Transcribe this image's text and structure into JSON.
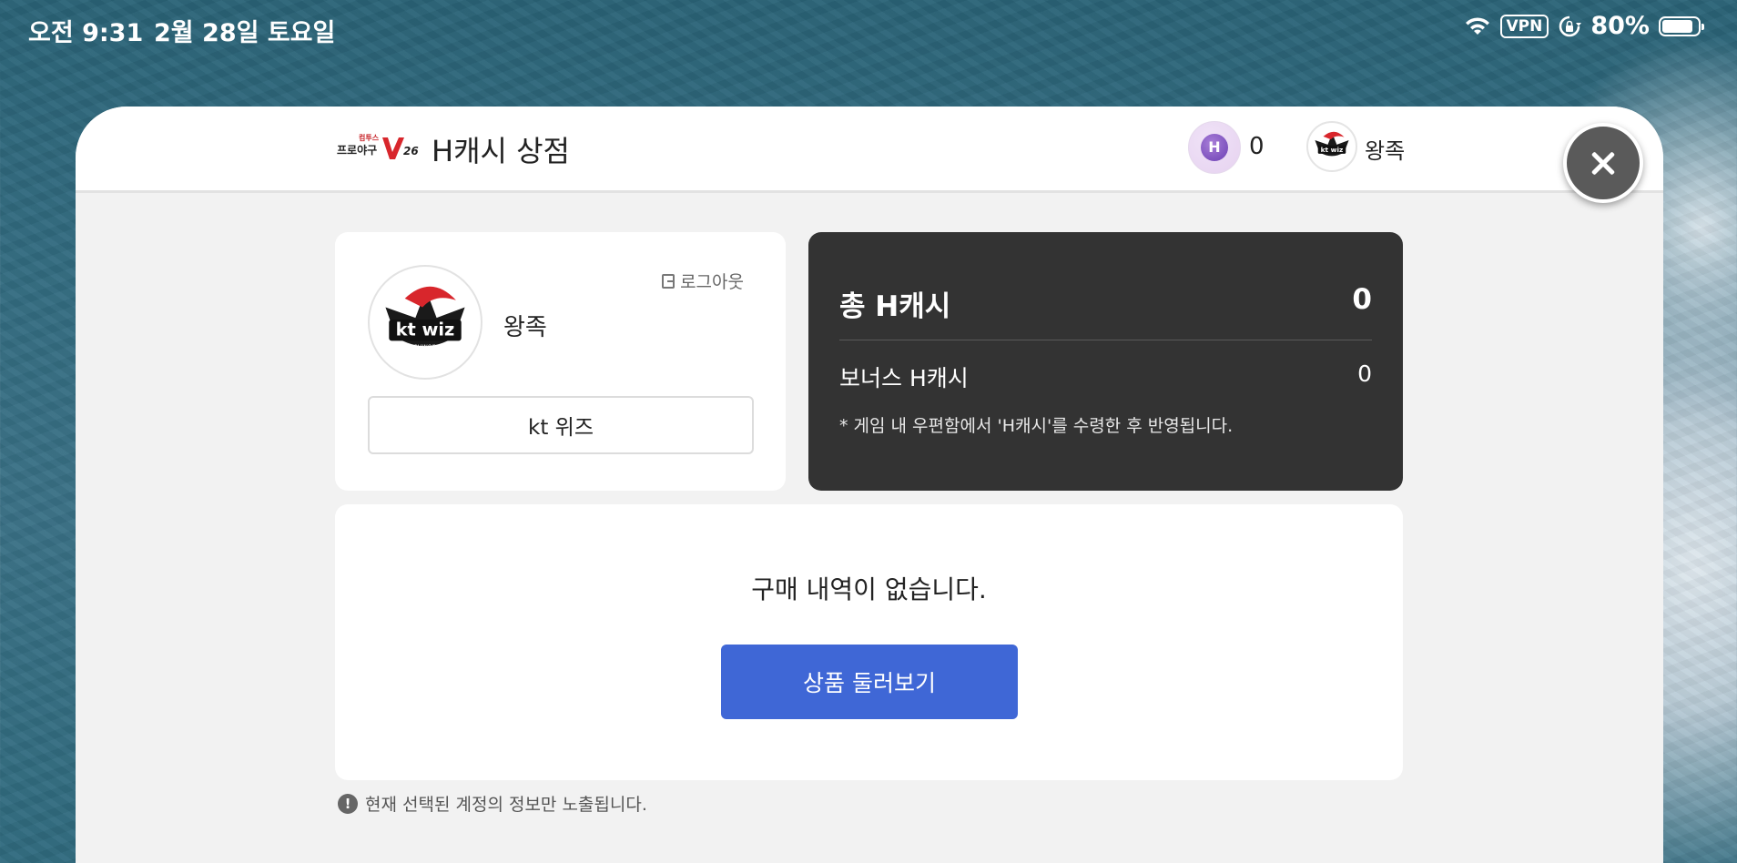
{
  "statusbar": {
    "time": "오전 9:31",
    "date": "2월 28일 토요일",
    "vpn": "VPN",
    "battery": "80%"
  },
  "header": {
    "logo_text": "컴투스 프로야구 V26",
    "title": "H캐시 상점",
    "coin_count": "0",
    "user_name": "왕족"
  },
  "profile": {
    "name": "왕족",
    "logout_label": "로그아웃",
    "team": "kt 위즈"
  },
  "cash": {
    "total_label": "총 H캐시",
    "total_value": "0",
    "bonus_label": "보너스 H캐시",
    "bonus_value": "0",
    "note": "* 게임 내 우편함에서 'H캐시'를 수령한 후 반영됩니다."
  },
  "history": {
    "empty_text": "구매 내역이 없습니다.",
    "browse_label": "상품 둘러보기"
  },
  "notice": {
    "text": "현재 선택된 계정의 정보만 노출됩니다."
  },
  "colors": {
    "accent": "#3f67d6",
    "dark_card": "#333333",
    "background": "#f2f2f2"
  }
}
